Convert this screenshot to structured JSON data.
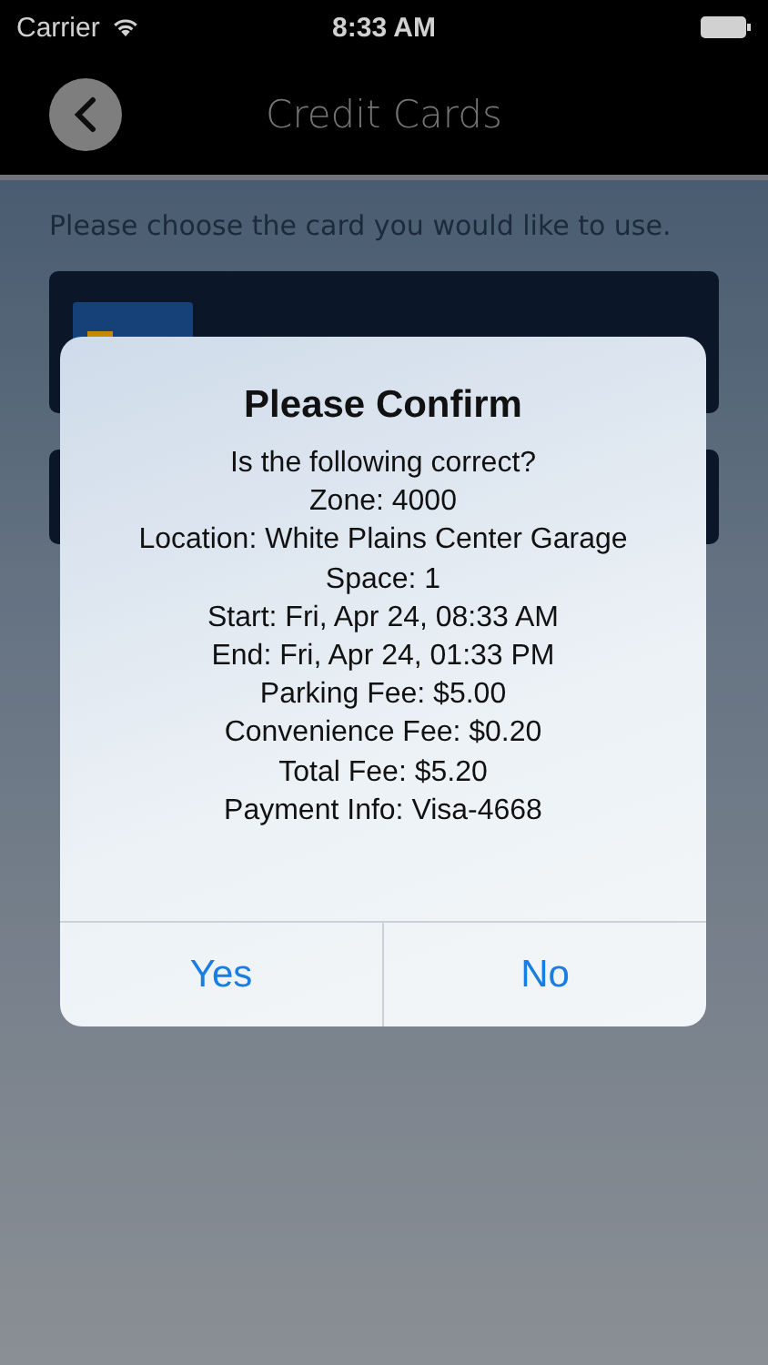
{
  "status_bar": {
    "carrier": "Carrier",
    "time": "8:33 AM"
  },
  "nav": {
    "title": "Credit Cards"
  },
  "instruction": "Please choose the card you would like to use.",
  "cards": [
    {
      "kind": "visa"
    },
    {
      "kind": "plain"
    }
  ],
  "dialog": {
    "title": "Please Confirm",
    "lines": [
      "Is the following correct?",
      "Zone: 4000",
      "Location: White Plains Center Garage",
      "Space: 1",
      "Start: Fri, Apr 24, 08:33 AM",
      "End: Fri, Apr 24, 01:33 PM",
      "Parking Fee: $5.00",
      "Convenience Fee: $0.20",
      "Total Fee: $5.20",
      "Payment Info: Visa-4668"
    ],
    "buttons": [
      "Yes",
      "No"
    ]
  }
}
